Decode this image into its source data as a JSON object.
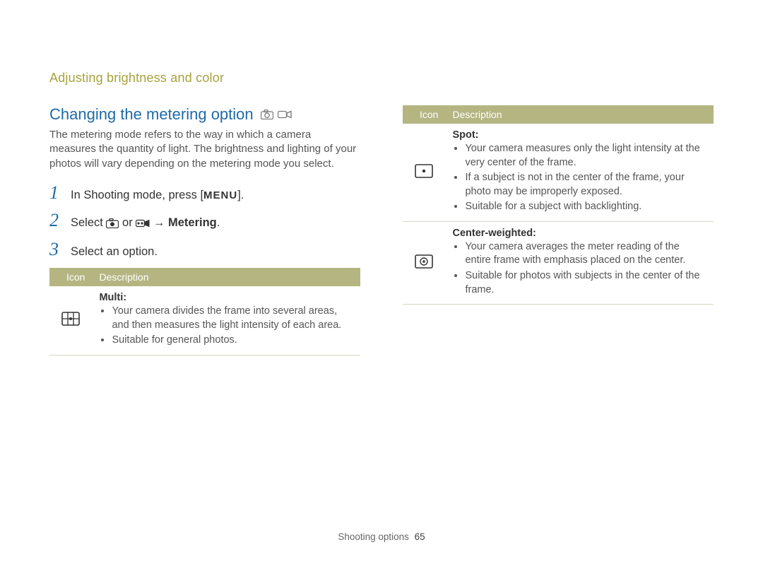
{
  "breadcrumb": "Adjusting brightness and color",
  "section_title": "Changing the metering option",
  "mode_icons": [
    "camera-icon",
    "camcorder-icon"
  ],
  "intro_text": "The metering mode refers to the way in which a camera measures the quantity of light. The brightness and lighting of your photos will vary depending on the metering mode you select.",
  "steps": {
    "num1": "1",
    "num2": "2",
    "num3": "3",
    "step1_a": "In Shooting mode, press [",
    "step1_menu": "MENU",
    "step1_b": "].",
    "step2_a": "Select ",
    "step2_or": " or ",
    "step2_arrow": " → ",
    "step2_metering": "Metering",
    "step2_dot": ".",
    "step3": "Select an option."
  },
  "table_headers": {
    "icon": "Icon",
    "description": "Description"
  },
  "metering_options": {
    "multi": {
      "title": "Multi:",
      "bullets": [
        "Your camera divides the frame into several areas, and then measures the light intensity of each area.",
        "Suitable for general photos."
      ]
    },
    "spot": {
      "title": "Spot:",
      "bullets": [
        "Your camera measures only the light intensity at the very center of the frame.",
        "If a subject is not in the center of the frame, your photo may be improperly exposed.",
        "Suitable for a subject with backlighting."
      ]
    },
    "center": {
      "title": "Center-weighted:",
      "bullets": [
        "Your camera averages the meter reading of the entire frame with emphasis placed on the center.",
        "Suitable for photos with subjects in the center of the frame."
      ]
    }
  },
  "footer": {
    "section": "Shooting options",
    "page": "65"
  }
}
